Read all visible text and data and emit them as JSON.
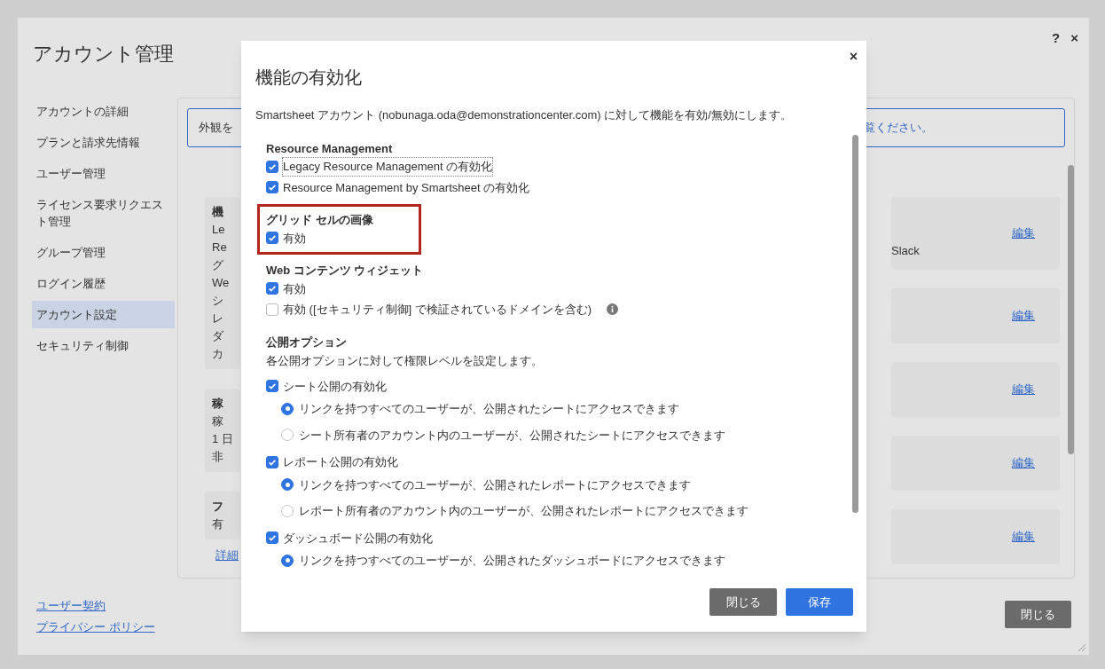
{
  "account_dialog": {
    "title": "アカウント管理",
    "help": "?",
    "close": "×",
    "nav": [
      {
        "label": "アカウントの詳細",
        "selected": false
      },
      {
        "label": "プランと請求先情報",
        "selected": false
      },
      {
        "label": "ユーザー管理",
        "selected": false
      },
      {
        "label": "ライセンス要求リクエスト管理",
        "selected": false
      },
      {
        "label": "グループ管理",
        "selected": false
      },
      {
        "label": "ログイン履歴",
        "selected": false
      },
      {
        "label": "アカウント設定",
        "selected": true
      },
      {
        "label": "セキュリティ制御",
        "selected": false
      }
    ],
    "footer_links": [
      "ユーザー契約",
      "プライバシー ポリシー"
    ],
    "banner": {
      "left": "外観を",
      "right": "覧ください。"
    },
    "left_cards": [
      {
        "lines": [
          "機",
          "Le",
          "Re",
          "グ",
          "We",
          "シ",
          "レ",
          "ダ",
          "カ"
        ]
      },
      {
        "lines": [
          "稼",
          "稼",
          "1 日",
          "非"
        ]
      },
      {
        "lines": [
          "フ",
          "有"
        ]
      }
    ],
    "details_link": "詳細",
    "right_cards": [
      {
        "text": "Slack",
        "edit": "編集"
      },
      {
        "edit": "編集"
      },
      {
        "edit": "編集"
      },
      {
        "edit": "編集"
      },
      {
        "edit": "編集"
      }
    ],
    "close_button": "閉じる"
  },
  "modal": {
    "title": "機能の有効化",
    "close": "×",
    "description": "Smartsheet アカウント (nobunaga.oda@demonstrationcenter.com) に対して機能を有効/無効にします。",
    "sections": [
      {
        "title": "Resource Management",
        "highlighted": false,
        "options": [
          {
            "kind": "checkbox",
            "label": "Legacy Resource Management の有効化",
            "checked": true,
            "focused": true
          },
          {
            "kind": "checkbox",
            "label": "Resource Management by Smartsheet の有効化",
            "checked": true,
            "focused": false
          }
        ]
      },
      {
        "title": "グリッド セルの画像",
        "highlighted": true,
        "options": [
          {
            "kind": "checkbox",
            "label": "有効",
            "checked": true,
            "focused": false
          }
        ]
      },
      {
        "title": "Web コンテンツ ウィジェット",
        "highlighted": false,
        "options": [
          {
            "kind": "checkbox",
            "label": "有効",
            "checked": true,
            "focused": false
          },
          {
            "kind": "checkbox",
            "label": "有効 ([セキュリティ制御] で検証されているドメインを含む)",
            "checked": false,
            "focused": false,
            "info": true
          }
        ]
      },
      {
        "title": "公開オプション",
        "highlighted": false,
        "description": "各公開オプションに対して権限レベルを設定します。",
        "options": [
          {
            "kind": "checkbox",
            "label": "シート公開の有効化",
            "checked": true,
            "focused": false,
            "children": [
              {
                "kind": "radio",
                "label": "リンクを持つすべてのユーザーが、公開されたシートにアクセスできます",
                "selected": true
              },
              {
                "kind": "radio",
                "label": "シート所有者のアカウント内のユーザーが、公開されたシートにアクセスできます",
                "selected": false
              }
            ]
          },
          {
            "kind": "checkbox",
            "label": "レポート公開の有効化",
            "checked": true,
            "focused": false,
            "children": [
              {
                "kind": "radio",
                "label": "リンクを持つすべてのユーザーが、公開されたレポートにアクセスできます",
                "selected": true
              },
              {
                "kind": "radio",
                "label": "レポート所有者のアカウント内のユーザーが、公開されたレポートにアクセスできます",
                "selected": false
              }
            ]
          },
          {
            "kind": "checkbox",
            "label": "ダッシュボード公開の有効化",
            "checked": true,
            "focused": false,
            "children": [
              {
                "kind": "radio",
                "label": "リンクを持つすべてのユーザーが、公開されたダッシュボードにアクセスできます",
                "selected": true
              }
            ]
          }
        ]
      }
    ],
    "buttons": [
      {
        "label": "閉じる",
        "kind": "secondary"
      },
      {
        "label": "保存",
        "kind": "primary"
      }
    ]
  }
}
